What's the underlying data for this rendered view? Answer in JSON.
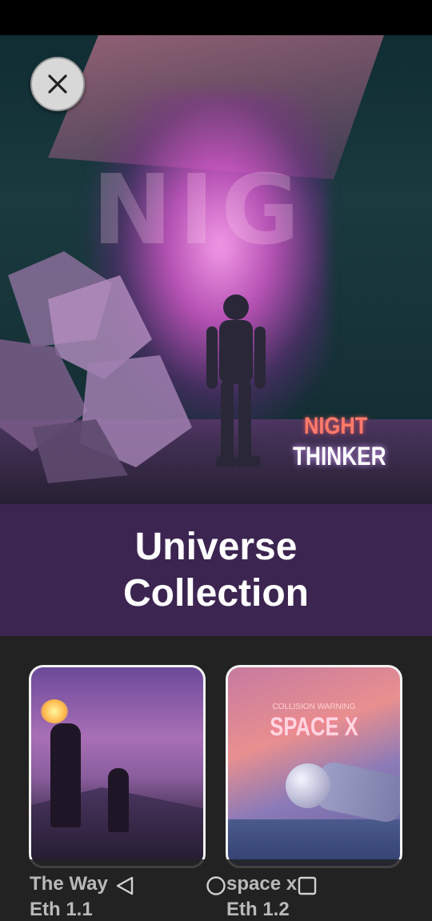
{
  "hero": {
    "album_title_line1": "NIGHT",
    "album_title_line2": "THINKER",
    "background_letters": "NIG"
  },
  "close_button": {
    "icon": "close-icon"
  },
  "collection": {
    "title": "Universe Collection"
  },
  "cards": [
    {
      "title": "The Way",
      "subtitle": "Eth 1.1"
    },
    {
      "title": "space x",
      "subtitle": "Eth 1.2",
      "art_text_small": "COLLISION WARNING",
      "art_text": "SPACE X"
    }
  ],
  "nav": {
    "back_icon": "back-triangle-icon",
    "home_icon": "home-circle-icon",
    "recent_icon": "recent-apps-square-icon"
  },
  "colors": {
    "title_band": "#3c2550",
    "background": "#222222",
    "card_border": "#f2f2f2",
    "label_text": "#b9b9b9"
  }
}
